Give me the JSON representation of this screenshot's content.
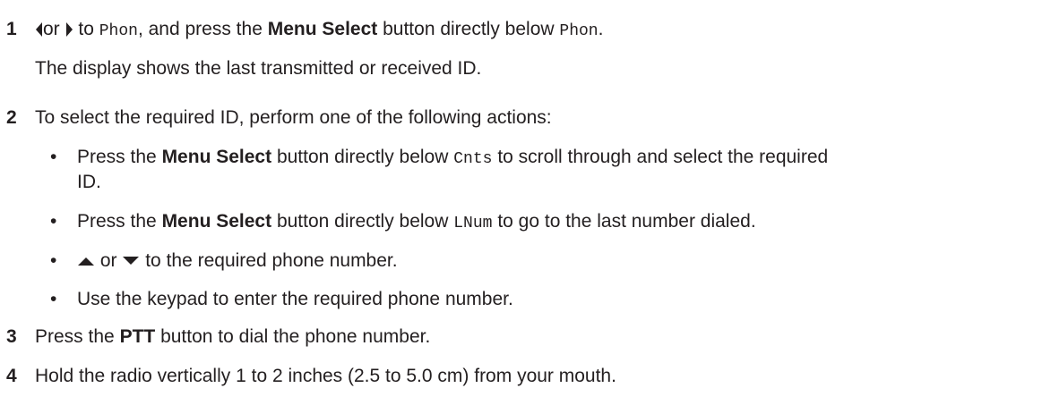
{
  "steps": [
    {
      "num": "1",
      "parts": [
        "or",
        "to",
        "Phon",
        ", and press the",
        "Menu Select",
        "button directly below",
        "Phon",
        "."
      ],
      "note": "The display shows the last transmitted or received ID."
    },
    {
      "num": "2",
      "text": "To select the required ID, perform one of the following actions:"
    },
    {
      "num": "3",
      "parts": [
        "Press the",
        "PTT",
        "button to dial the phone number."
      ]
    },
    {
      "num": "4",
      "text": "Hold the radio vertically 1 to 2 inches (2.5 to 5.0 cm) from your mouth."
    }
  ],
  "bullet_char": "•",
  "bullets": [
    {
      "parts": [
        "Press the",
        "Menu Select",
        "button directly below",
        "Cnts",
        "to scroll through and select the required"
      ],
      "cont": "ID."
    },
    {
      "parts": [
        "Press the",
        "Menu Select",
        "button directly below",
        "LNum",
        "to go to the last number dialed."
      ]
    },
    {
      "parts": [
        "or",
        "to the required phone number."
      ]
    },
    {
      "text": "Use the keypad to enter the required phone number."
    }
  ],
  "icons": {
    "left": "left-arrow-icon",
    "right": "right-arrow-icon",
    "up": "up-arrow-icon",
    "down": "down-arrow-icon"
  }
}
